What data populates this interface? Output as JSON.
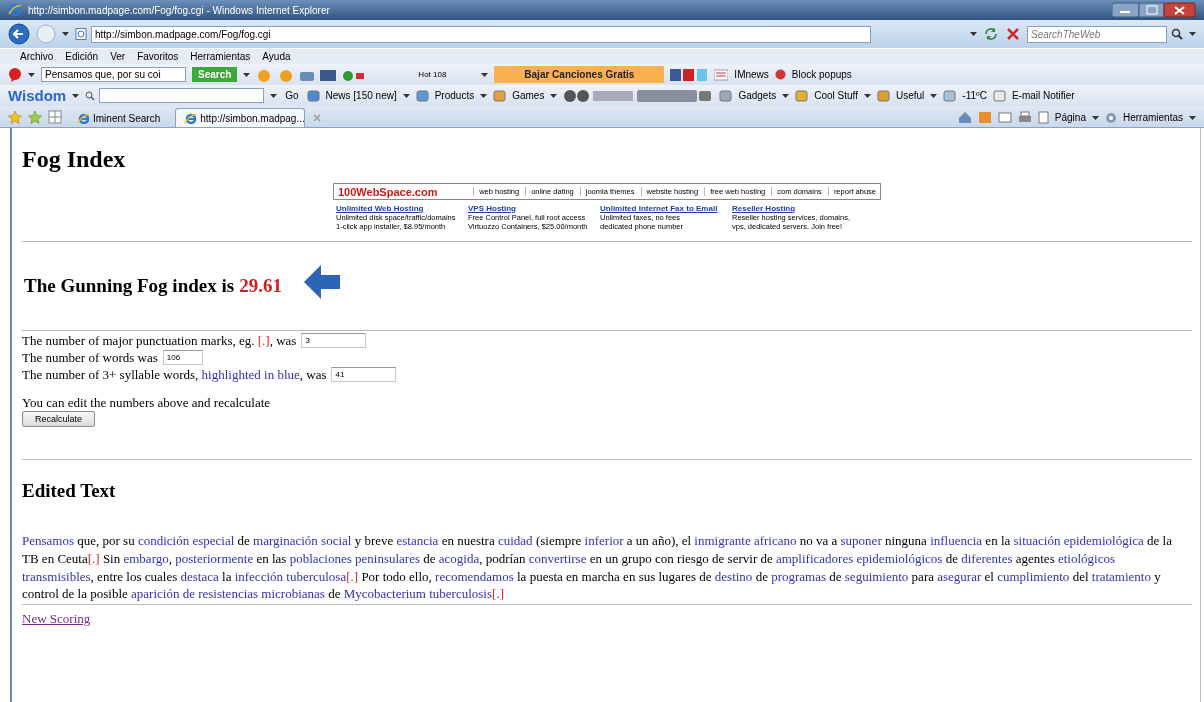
{
  "window": {
    "title": "http://simbon.madpage.com/Fog/fog.cgi - Windows Internet Explorer"
  },
  "address_bar": {
    "url": "http://simbon.madpage.com/Fog/fog.cgi"
  },
  "web_search": {
    "placeholder": "SearchTheWeb"
  },
  "menu": [
    "Archivo",
    "Edición",
    "Ver",
    "Favoritos",
    "Herramientas",
    "Ayuda"
  ],
  "toolbar_1": {
    "search_value": "Pensamos que, por su coi",
    "search_button": "Search",
    "radio_station": "Hot 108",
    "promo_button": "Bajar Canciones Gratis",
    "items": [
      "IMnews",
      "Block popups"
    ]
  },
  "toolbar_2": {
    "brand": "Wisdom",
    "go_button": "Go",
    "items": [
      {
        "label": "News [150 new]"
      },
      {
        "label": "Products"
      },
      {
        "label": "Games"
      },
      {
        "label": "Gadgets"
      },
      {
        "label": "Cool Stuff"
      },
      {
        "label": "Useful"
      },
      {
        "label": "-11ºC"
      },
      {
        "label": "E-mail Notifier"
      }
    ]
  },
  "tabs": [
    {
      "label": "Iminent Search",
      "selected": false
    },
    {
      "label": "http://simbon.madpag...",
      "selected": true
    }
  ],
  "command_bar": [
    "Página",
    "Herramientas"
  ],
  "page": {
    "title": "Fog Index",
    "ad": {
      "brand": "100WebSpace.com",
      "links": [
        "web hosting",
        "online dating",
        "joomla themes",
        "website hosting",
        "free web hosting",
        "com domains",
        "report abuse"
      ],
      "offers": [
        {
          "title": "Unlimited Web Hosting",
          "lines": [
            "Unlimited disk space/traffic/domains",
            "1-click app installer, $8.95/month"
          ]
        },
        {
          "title": "VPS Hosting",
          "lines": [
            "Free Control Panel, full root access",
            "Virtuozzo Containers, $25.00/month"
          ]
        },
        {
          "title": "Unlimited Internet Fax to Email",
          "lines": [
            "Unlimited faxes, no fees",
            "dedicated phone number"
          ]
        },
        {
          "title": "Reseller Hosting",
          "lines": [
            "Reseller hosting services, domains,",
            "vps, dedicated servers. Join free!"
          ]
        }
      ]
    },
    "result": {
      "label": "The Gunning Fog index is",
      "value": "29.61"
    },
    "counts": [
      {
        "segments": [
          {
            "kind": "plain",
            "text": "The number of major punctuation marks, eg. "
          },
          {
            "kind": "mark",
            "text": "[.]"
          },
          {
            "kind": "plain",
            "text": ", was"
          }
        ],
        "value": "3"
      },
      {
        "segments": [
          {
            "kind": "plain",
            "text": "The number of words was"
          }
        ],
        "value": "106"
      },
      {
        "segments": [
          {
            "kind": "plain",
            "text": "The number of 3+ syllable words, "
          },
          {
            "kind": "hard",
            "text": "highlighted in blue"
          },
          {
            "kind": "plain",
            "text": ", was"
          }
        ],
        "value": "41"
      }
    ],
    "note": "You can edit the numbers above and recalculate",
    "recalculate_button": "Recalculate",
    "edited_heading": "Edited Text",
    "edited_text": [
      {
        "kind": "hard",
        "text": "Pensamos"
      },
      {
        "kind": "plain",
        "text": " que, por su "
      },
      {
        "kind": "hard",
        "text": "condición especial"
      },
      {
        "kind": "plain",
        "text": " de "
      },
      {
        "kind": "hard",
        "text": "marginación social"
      },
      {
        "kind": "plain",
        "text": " y breve "
      },
      {
        "kind": "hard",
        "text": "estancia"
      },
      {
        "kind": "plain",
        "text": " en nuestra "
      },
      {
        "kind": "hard",
        "text": "cuidad"
      },
      {
        "kind": "plain",
        "text": " (siempre "
      },
      {
        "kind": "hard",
        "text": "inferior"
      },
      {
        "kind": "plain",
        "text": " a un año), el "
      },
      {
        "kind": "hard",
        "text": "inmigrante africano"
      },
      {
        "kind": "plain",
        "text": " no va a "
      },
      {
        "kind": "hard",
        "text": "suponer"
      },
      {
        "kind": "plain",
        "text": " ninguna "
      },
      {
        "kind": "hard",
        "text": "influencia"
      },
      {
        "kind": "plain",
        "text": " en la "
      },
      {
        "kind": "hard",
        "text": "situación epidemiológica"
      },
      {
        "kind": "plain",
        "text": " de la TB en Ceuta"
      },
      {
        "kind": "mark",
        "text": "[.]"
      },
      {
        "kind": "plain",
        "text": " Sin "
      },
      {
        "kind": "hard",
        "text": "embargo"
      },
      {
        "kind": "plain",
        "text": ", "
      },
      {
        "kind": "hard",
        "text": "posteriormente"
      },
      {
        "kind": "plain",
        "text": " en las "
      },
      {
        "kind": "hard",
        "text": "poblaciones peninsulares"
      },
      {
        "kind": "plain",
        "text": " de "
      },
      {
        "kind": "hard",
        "text": "acogida"
      },
      {
        "kind": "plain",
        "text": ", podrían "
      },
      {
        "kind": "hard",
        "text": "convertirse"
      },
      {
        "kind": "plain",
        "text": " en un grupo con riesgo de servir de "
      },
      {
        "kind": "hard",
        "text": "amplificadores epidemiológicos"
      },
      {
        "kind": "plain",
        "text": " de "
      },
      {
        "kind": "hard",
        "text": "diferentes"
      },
      {
        "kind": "plain",
        "text": " agentes "
      },
      {
        "kind": "hard",
        "text": "etiológicos transmisibles"
      },
      {
        "kind": "plain",
        "text": ", entre los cuales "
      },
      {
        "kind": "hard",
        "text": "destaca"
      },
      {
        "kind": "plain",
        "text": " la "
      },
      {
        "kind": "hard",
        "text": "infección tuberculosa"
      },
      {
        "kind": "mark",
        "text": "[.]"
      },
      {
        "kind": "plain",
        "text": " Por todo ello, "
      },
      {
        "kind": "hard",
        "text": "recomendamos"
      },
      {
        "kind": "plain",
        "text": " la puesta en marcha en sus lugares de "
      },
      {
        "kind": "hard",
        "text": "destino"
      },
      {
        "kind": "plain",
        "text": " de "
      },
      {
        "kind": "hard",
        "text": "programas"
      },
      {
        "kind": "plain",
        "text": " de "
      },
      {
        "kind": "hard",
        "text": "seguimiento"
      },
      {
        "kind": "plain",
        "text": " para "
      },
      {
        "kind": "hard",
        "text": "asegurar"
      },
      {
        "kind": "plain",
        "text": " el "
      },
      {
        "kind": "hard",
        "text": "cumplimiento"
      },
      {
        "kind": "plain",
        "text": " del "
      },
      {
        "kind": "hard",
        "text": "tratamiento"
      },
      {
        "kind": "plain",
        "text": " y control de la posible "
      },
      {
        "kind": "hard",
        "text": "aparición de resistencias microbianas"
      },
      {
        "kind": "plain",
        "text": " de "
      },
      {
        "kind": "hard",
        "text": "Mycobacterium tuberculosis"
      },
      {
        "kind": "mark",
        "text": "[.]"
      }
    ],
    "new_scoring_link": "New Scoring"
  }
}
